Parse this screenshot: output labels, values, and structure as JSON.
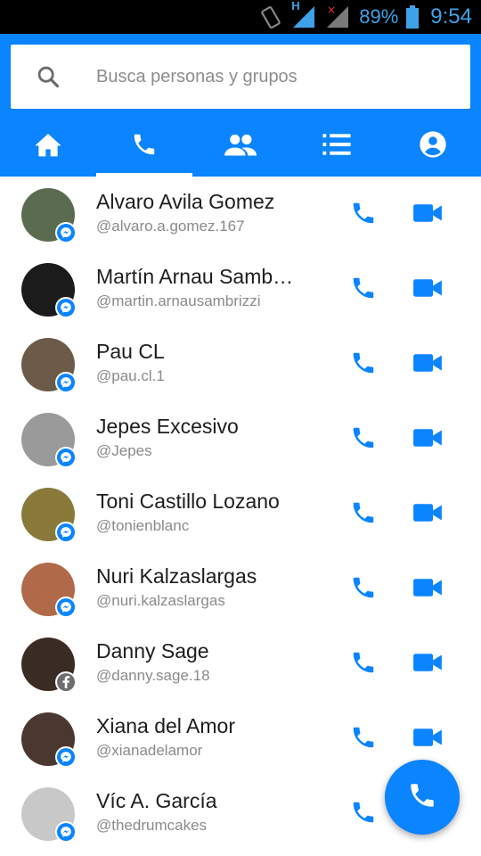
{
  "status_bar": {
    "signal_1": "H",
    "battery_percent": "89%",
    "time": "9:54"
  },
  "search": {
    "placeholder": "Busca personas y grupos"
  },
  "tabs": [
    {
      "name": "home-icon",
      "active": false
    },
    {
      "name": "phone-icon",
      "active": true
    },
    {
      "name": "people-icon",
      "active": false
    },
    {
      "name": "list-icon",
      "active": false
    },
    {
      "name": "profile-icon",
      "active": false
    }
  ],
  "colors": {
    "accent": "#0a84ff",
    "status_icons": "#3ea2e8",
    "name_text": "#1d1d1d",
    "handle_text": "#8a8a8a"
  },
  "contacts": [
    {
      "name": "Alvaro Avila Gomez",
      "handle": "@alvaro.a.gomez.167",
      "badge": "messenger",
      "avatar_color": "#5a6b4f"
    },
    {
      "name": "Martín Arnau Samb…",
      "handle": "@martin.arnausambrizzi",
      "badge": "messenger",
      "avatar_color": "#1b1b1b"
    },
    {
      "name": "Pau CL",
      "handle": "@pau.cl.1",
      "badge": "messenger",
      "avatar_color": "#6b5a48"
    },
    {
      "name": "Jepes Excesivo",
      "handle": "@Jepes",
      "badge": "messenger",
      "avatar_color": "#9a9a9a"
    },
    {
      "name": "Toni Castillo Lozano",
      "handle": "@tonienblanc",
      "badge": "messenger",
      "avatar_color": "#8a7a3a"
    },
    {
      "name": "Nuri Kalzaslargas",
      "handle": "@nuri.kalzaslargas",
      "badge": "messenger",
      "avatar_color": "#b06a4a"
    },
    {
      "name": "Danny Sage",
      "handle": "@danny.sage.18",
      "badge": "facebook",
      "avatar_color": "#3a2c24"
    },
    {
      "name": "Xiana del Amor",
      "handle": "@xianadelamor",
      "badge": "messenger",
      "avatar_color": "#4a3830"
    },
    {
      "name": "Víc A. García",
      "handle": "@thedrumcakes",
      "badge": "messenger",
      "avatar_color": "#c8c8c8"
    }
  ]
}
